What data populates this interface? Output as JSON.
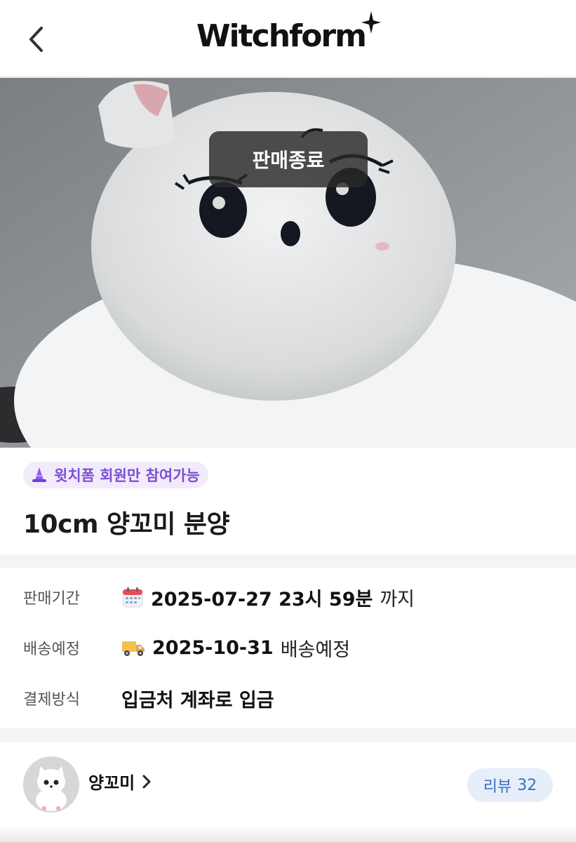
{
  "header": {
    "back_icon": "chevron-left-icon",
    "logo_text": "Witchform",
    "logo_star_icon": "sparkle-star-icon"
  },
  "hero": {
    "image_subject": "plush-cat-doll-photo",
    "status_badge": "판매종료"
  },
  "product": {
    "member_only_icon": "witch-hat-icon",
    "member_only_label": "윗치폼 회원만 참여가능",
    "title": "10cm 양꼬미 분양"
  },
  "details": {
    "sale_period": {
      "label": "판매기간",
      "icon": "calendar-icon",
      "date": "2025-07-27 23시 59분",
      "suffix": "까지"
    },
    "shipping": {
      "label": "배송예정",
      "icon": "delivery-truck-icon",
      "date": "2025-10-31",
      "suffix": "배송예정"
    },
    "payment": {
      "label": "결제방식",
      "value": "입금처 계좌로 입금"
    }
  },
  "seller": {
    "name": "양꼬미",
    "chevron_icon": "chevron-right-icon",
    "review_label": "리뷰",
    "review_count": "32"
  },
  "colors": {
    "accent_purple": "#7d4fd6",
    "chip_bg": "#f1ebfb",
    "review_blue": "#3a6fc4",
    "review_bg": "#e6eef9"
  }
}
